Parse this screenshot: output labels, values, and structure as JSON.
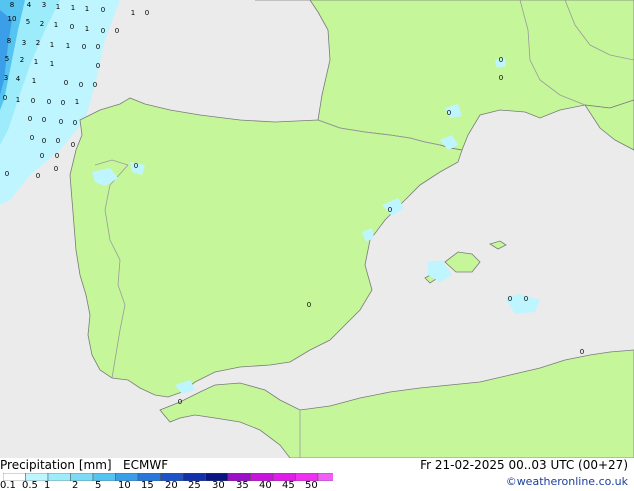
{
  "footer": {
    "title": "Precipitation [mm]",
    "model": "ECMWF",
    "datetime": "Fr 21-02-2025 00..03 UTC (00+27)",
    "credit": "©weatheronline.co.uk"
  },
  "legend": {
    "labels": [
      "0.1",
      "0.5",
      "1",
      "2",
      "5",
      "10",
      "15",
      "20",
      "25",
      "30",
      "35",
      "40",
      "45",
      "50"
    ],
    "colors": [
      "#ffffff",
      "#bff5ff",
      "#9cecfc",
      "#7cdcf6",
      "#56c4f0",
      "#3a9ee8",
      "#2a77dc",
      "#1d52c8",
      "#1230a8",
      "#0a1680",
      "#9a10c8",
      "#c814dc",
      "#e01ce8",
      "#f030f0",
      "#f060f8"
    ]
  },
  "colors": {
    "sea": "#ebebeb",
    "land": "#c5f79a",
    "border": "#9a9a9a",
    "coast": "#7a7a7a",
    "precip_light": "#bff5ff",
    "precip_mid": "#7cdcf6",
    "precip_heavy": "#3a9ee8"
  },
  "precip_values": [
    {
      "v": "8"
    },
    {
      "v": "4"
    },
    {
      "v": "3"
    },
    {
      "v": "1"
    },
    {
      "v": "1"
    },
    {
      "v": "1"
    },
    {
      "v": "0"
    },
    {
      "v": "1"
    },
    {
      "v": "0"
    },
    {
      "v": "10"
    },
    {
      "v": "5"
    },
    {
      "v": "2"
    },
    {
      "v": "1"
    },
    {
      "v": "0"
    },
    {
      "v": "1"
    },
    {
      "v": "0"
    },
    {
      "v": "0"
    },
    {
      "v": "8"
    },
    {
      "v": "3"
    },
    {
      "v": "2"
    },
    {
      "v": "1"
    },
    {
      "v": "1"
    },
    {
      "v": "0"
    },
    {
      "v": "0"
    },
    {
      "v": "5"
    },
    {
      "v": "2"
    },
    {
      "v": "1"
    },
    {
      "v": "1"
    },
    {
      "v": "0"
    },
    {
      "v": "3"
    },
    {
      "v": "4"
    },
    {
      "v": "1"
    },
    {
      "v": "0"
    },
    {
      "v": "0"
    },
    {
      "v": "0"
    },
    {
      "v": "0"
    },
    {
      "v": "1"
    },
    {
      "v": "0"
    },
    {
      "v": "0"
    },
    {
      "v": "0"
    },
    {
      "v": "1"
    },
    {
      "v": "0"
    },
    {
      "v": "0"
    },
    {
      "v": "0"
    },
    {
      "v": "0"
    },
    {
      "v": "0"
    },
    {
      "v": "0"
    },
    {
      "v": "0"
    },
    {
      "v": "0"
    },
    {
      "v": "0"
    },
    {
      "v": "0"
    },
    {
      "v": "0"
    },
    {
      "v": "0"
    },
    {
      "v": "0"
    },
    {
      "v": "0"
    },
    {
      "v": "0"
    },
    {
      "v": "0"
    },
    {
      "v": "0"
    },
    {
      "v": "0"
    },
    {
      "v": "0"
    },
    {
      "v": "0"
    },
    {
      "v": "0"
    },
    {
      "v": "0"
    },
    {
      "v": "0"
    }
  ]
}
